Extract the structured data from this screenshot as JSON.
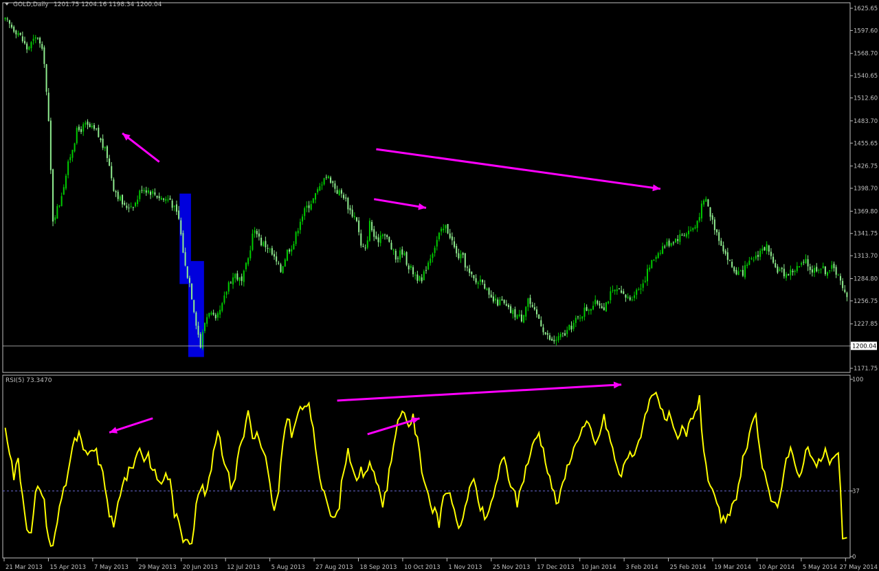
{
  "chart_data": [
    {
      "type": "candlestick",
      "title": "GOLD,Daily",
      "ohlc_readout": "1201.75 1204.16 1198.34 1200.04",
      "current_price": 1200.04,
      "y_ticks": [
        1171.75,
        1200.04,
        1227.85,
        1256.75,
        1284.8,
        1313.7,
        1341.75,
        1369.8,
        1398.7,
        1426.75,
        1455.65,
        1483.7,
        1512.6,
        1540.65,
        1568.7,
        1597.6,
        1625.65
      ],
      "ylim": [
        1171.75,
        1625.65
      ],
      "x_ticks": [
        "21 Mar 2013",
        "15 Apr 2013",
        "7 May 2013",
        "29 May 2013",
        "20 Jun 2013",
        "12 Jul 2013",
        "5 Aug 2013",
        "27 Aug 2013",
        "18 Sep 2013",
        "10 Oct 2013",
        "1 Nov 2013",
        "25 Nov 2013",
        "17 Dec 2013",
        "10 Jan 2014",
        "3 Feb 2014",
        "25 Feb 2014",
        "19 Mar 2014",
        "10 Apr 2014",
        "5 May 2014",
        "27 May 2014"
      ],
      "close_anchors": [
        [
          0,
          1610
        ],
        [
          6,
          1595
        ],
        [
          10,
          1575
        ],
        [
          15,
          1590
        ],
        [
          18,
          1560
        ],
        [
          20,
          1480
        ],
        [
          22,
          1360
        ],
        [
          25,
          1380
        ],
        [
          30,
          1440
        ],
        [
          33,
          1470
        ],
        [
          37,
          1478
        ],
        [
          42,
          1470
        ],
        [
          47,
          1440
        ],
        [
          50,
          1400
        ],
        [
          55,
          1375
        ],
        [
          60,
          1380
        ],
        [
          63,
          1400
        ],
        [
          67,
          1395
        ],
        [
          70,
          1390
        ],
        [
          73,
          1385
        ],
        [
          76,
          1385
        ],
        [
          80,
          1360
        ],
        [
          83,
          1300
        ],
        [
          85,
          1280
        ],
        [
          88,
          1230
        ],
        [
          90,
          1200
        ],
        [
          92,
          1230
        ],
        [
          94,
          1245
        ],
        [
          97,
          1230
        ],
        [
          100,
          1250
        ],
        [
          103,
          1280
        ],
        [
          106,
          1290
        ],
        [
          109,
          1280
        ],
        [
          112,
          1310
        ],
        [
          114,
          1340
        ],
        [
          116,
          1345
        ],
        [
          118,
          1330
        ],
        [
          121,
          1325
        ],
        [
          124,
          1310
        ],
        [
          127,
          1295
        ],
        [
          130,
          1320
        ],
        [
          133,
          1330
        ],
        [
          136,
          1360
        ],
        [
          139,
          1375
        ],
        [
          142,
          1385
        ],
        [
          145,
          1400
        ],
        [
          147,
          1415
        ],
        [
          150,
          1410
        ],
        [
          153,
          1395
        ],
        [
          156,
          1390
        ],
        [
          159,
          1370
        ],
        [
          162,
          1360
        ],
        [
          164,
          1325
        ],
        [
          166,
          1320
        ],
        [
          168,
          1355
        ],
        [
          171,
          1330
        ],
        [
          174,
          1345
        ],
        [
          177,
          1330
        ],
        [
          180,
          1310
        ],
        [
          183,
          1320
        ],
        [
          186,
          1300
        ],
        [
          189,
          1290
        ],
        [
          192,
          1280
        ],
        [
          194,
          1300
        ],
        [
          197,
          1320
        ],
        [
          200,
          1340
        ],
        [
          203,
          1350
        ],
        [
          205,
          1340
        ],
        [
          208,
          1315
        ],
        [
          211,
          1310
        ],
        [
          214,
          1290
        ],
        [
          217,
          1280
        ],
        [
          220,
          1285
        ],
        [
          223,
          1260
        ],
        [
          226,
          1255
        ],
        [
          229,
          1255
        ],
        [
          232,
          1245
        ],
        [
          235,
          1240
        ],
        [
          238,
          1235
        ],
        [
          241,
          1260
        ],
        [
          243,
          1245
        ],
        [
          246,
          1235
        ],
        [
          249,
          1215
        ],
        [
          252,
          1205
        ],
        [
          255,
          1210
        ],
        [
          258,
          1215
        ],
        [
          261,
          1225
        ],
        [
          264,
          1235
        ],
        [
          267,
          1245
        ],
        [
          270,
          1250
        ],
        [
          273,
          1255
        ],
        [
          276,
          1250
        ],
        [
          279,
          1265
        ],
        [
          282,
          1270
        ],
        [
          285,
          1262
        ],
        [
          288,
          1260
        ],
        [
          291,
          1270
        ],
        [
          294,
          1280
        ],
        [
          297,
          1300
        ],
        [
          300,
          1315
        ],
        [
          303,
          1325
        ],
        [
          306,
          1330
        ],
        [
          309,
          1335
        ],
        [
          312,
          1340
        ],
        [
          315,
          1345
        ],
        [
          318,
          1350
        ],
        [
          321,
          1375
        ],
        [
          323,
          1385
        ],
        [
          325,
          1365
        ],
        [
          327,
          1350
        ],
        [
          330,
          1330
        ],
        [
          333,
          1310
        ],
        [
          336,
          1295
        ],
        [
          339,
          1290
        ],
        [
          342,
          1300
        ],
        [
          345,
          1310
        ],
        [
          348,
          1320
        ],
        [
          351,
          1325
        ],
        [
          354,
          1300
        ],
        [
          357,
          1295
        ],
        [
          360,
          1290
        ],
        [
          363,
          1295
        ],
        [
          366,
          1300
        ],
        [
          369,
          1305
        ],
        [
          372,
          1295
        ],
        [
          375,
          1300
        ],
        [
          378,
          1295
        ],
        [
          381,
          1298
        ],
        [
          384,
          1292
        ],
        [
          386,
          1270
        ],
        [
          388,
          1260
        ]
      ],
      "bars": 389,
      "up_color": "#00cc00",
      "down_color": "#90ee90",
      "highlight_boxes": [
        {
          "from_bar": 81,
          "to_bar": 85,
          "price_top": 1392,
          "price_bottom": 1278
        },
        {
          "from_bar": 85,
          "to_bar": 91,
          "price_top": 1307,
          "price_bottom": 1186
        }
      ],
      "trend_arrows": [
        {
          "from": [
            71,
            1432
          ],
          "to": [
            54,
            1468
          ]
        },
        {
          "from": [
            170,
            1385
          ],
          "to": [
            194,
            1374
          ]
        },
        {
          "from": [
            171,
            1448
          ],
          "to": [
            302,
            1398
          ]
        }
      ]
    },
    {
      "type": "line",
      "title": "RSI(5) 73.3470",
      "series": [
        {
          "name": "RSI(5)",
          "color": "#ffff00"
        }
      ],
      "ylim": [
        0,
        100
      ],
      "y_ticks": [
        0,
        37,
        100
      ],
      "level": 37,
      "anchors": [
        [
          0,
          75
        ],
        [
          2,
          60
        ],
        [
          4,
          45
        ],
        [
          6,
          55
        ],
        [
          8,
          35
        ],
        [
          10,
          18
        ],
        [
          12,
          12
        ],
        [
          14,
          35
        ],
        [
          16,
          40
        ],
        [
          18,
          30
        ],
        [
          20,
          10
        ],
        [
          22,
          5
        ],
        [
          24,
          20
        ],
        [
          26,
          35
        ],
        [
          28,
          42
        ],
        [
          30,
          55
        ],
        [
          32,
          65
        ],
        [
          34,
          68
        ],
        [
          36,
          60
        ],
        [
          38,
          55
        ],
        [
          40,
          62
        ],
        [
          42,
          58
        ],
        [
          44,
          50
        ],
        [
          46,
          40
        ],
        [
          48,
          25
        ],
        [
          50,
          15
        ],
        [
          52,
          30
        ],
        [
          54,
          42
        ],
        [
          56,
          45
        ],
        [
          58,
          50
        ],
        [
          60,
          55
        ],
        [
          62,
          62
        ],
        [
          64,
          55
        ],
        [
          66,
          58
        ],
        [
          68,
          48
        ],
        [
          70,
          45
        ],
        [
          72,
          40
        ],
        [
          74,
          48
        ],
        [
          76,
          42
        ],
        [
          78,
          25
        ],
        [
          80,
          18
        ],
        [
          82,
          10
        ],
        [
          84,
          12
        ],
        [
          86,
          8
        ],
        [
          88,
          28
        ],
        [
          90,
          40
        ],
        [
          92,
          35
        ],
        [
          94,
          42
        ],
        [
          96,
          60
        ],
        [
          98,
          72
        ],
        [
          100,
          60
        ],
        [
          102,
          50
        ],
        [
          104,
          40
        ],
        [
          106,
          45
        ],
        [
          108,
          62
        ],
        [
          110,
          68
        ],
        [
          112,
          85
        ],
        [
          114,
          65
        ],
        [
          116,
          70
        ],
        [
          118,
          60
        ],
        [
          120,
          55
        ],
        [
          122,
          40
        ],
        [
          124,
          25
        ],
        [
          126,
          35
        ],
        [
          128,
          65
        ],
        [
          130,
          80
        ],
        [
          132,
          70
        ],
        [
          134,
          75
        ],
        [
          136,
          85
        ],
        [
          138,
          82
        ],
        [
          140,
          88
        ],
        [
          142,
          70
        ],
        [
          144,
          50
        ],
        [
          146,
          40
        ],
        [
          148,
          35
        ],
        [
          150,
          25
        ],
        [
          152,
          20
        ],
        [
          154,
          30
        ],
        [
          156,
          50
        ],
        [
          158,
          60
        ],
        [
          160,
          52
        ],
        [
          162,
          40
        ],
        [
          164,
          48
        ],
        [
          166,
          45
        ],
        [
          168,
          55
        ],
        [
          170,
          45
        ],
        [
          172,
          40
        ],
        [
          174,
          30
        ],
        [
          176,
          40
        ],
        [
          178,
          55
        ],
        [
          180,
          72
        ],
        [
          182,
          78
        ],
        [
          184,
          80
        ],
        [
          186,
          75
        ],
        [
          188,
          78
        ],
        [
          190,
          65
        ],
        [
          192,
          50
        ],
        [
          194,
          40
        ],
        [
          196,
          30
        ],
        [
          198,
          25
        ],
        [
          200,
          18
        ],
        [
          202,
          35
        ],
        [
          204,
          38
        ],
        [
          206,
          28
        ],
        [
          208,
          22
        ],
        [
          210,
          15
        ],
        [
          212,
          28
        ],
        [
          214,
          40
        ],
        [
          216,
          42
        ],
        [
          218,
          30
        ],
        [
          220,
          25
        ],
        [
          222,
          20
        ],
        [
          224,
          30
        ],
        [
          226,
          40
        ],
        [
          228,
          50
        ],
        [
          230,
          55
        ],
        [
          232,
          45
        ],
        [
          234,
          38
        ],
        [
          236,
          30
        ],
        [
          238,
          40
        ],
        [
          240,
          50
        ],
        [
          242,
          58
        ],
        [
          244,
          65
        ],
        [
          246,
          70
        ],
        [
          248,
          60
        ],
        [
          250,
          50
        ],
        [
          252,
          40
        ],
        [
          254,
          30
        ],
        [
          256,
          35
        ],
        [
          258,
          45
        ],
        [
          260,
          55
        ],
        [
          262,
          60
        ],
        [
          264,
          68
        ],
        [
          266,
          72
        ],
        [
          268,
          75
        ],
        [
          270,
          70
        ],
        [
          272,
          62
        ],
        [
          274,
          70
        ],
        [
          276,
          78
        ],
        [
          278,
          70
        ],
        [
          280,
          60
        ],
        [
          282,
          50
        ],
        [
          284,
          45
        ],
        [
          286,
          55
        ],
        [
          288,
          60
        ],
        [
          290,
          55
        ],
        [
          292,
          65
        ],
        [
          294,
          75
        ],
        [
          296,
          85
        ],
        [
          298,
          90
        ],
        [
          300,
          95
        ],
        [
          302,
          85
        ],
        [
          304,
          75
        ],
        [
          306,
          80
        ],
        [
          308,
          70
        ],
        [
          310,
          65
        ],
        [
          312,
          72
        ],
        [
          314,
          68
        ],
        [
          316,
          78
        ],
        [
          318,
          82
        ],
        [
          320,
          88
        ],
        [
          322,
          60
        ],
        [
          324,
          45
        ],
        [
          326,
          35
        ],
        [
          328,
          28
        ],
        [
          330,
          22
        ],
        [
          332,
          18
        ],
        [
          334,
          25
        ],
        [
          336,
          30
        ],
        [
          338,
          40
        ],
        [
          340,
          55
        ],
        [
          342,
          62
        ],
        [
          344,
          72
        ],
        [
          346,
          78
        ],
        [
          348,
          60
        ],
        [
          350,
          45
        ],
        [
          352,
          35
        ],
        [
          354,
          28
        ],
        [
          356,
          30
        ],
        [
          358,
          42
        ],
        [
          360,
          55
        ],
        [
          362,
          60
        ],
        [
          364,
          50
        ],
        [
          366,
          45
        ],
        [
          368,
          55
        ],
        [
          370,
          62
        ],
        [
          372,
          58
        ],
        [
          374,
          50
        ],
        [
          376,
          55
        ],
        [
          378,
          60
        ],
        [
          380,
          52
        ],
        [
          382,
          55
        ],
        [
          384,
          58
        ],
        [
          386,
          12
        ],
        [
          388,
          8
        ]
      ],
      "x_ticks": [
        "21 Mar 2013",
        "15 Apr 2013",
        "7 May 2013",
        "29 May 2013",
        "20 Jun 2013",
        "12 Jul 2013",
        "5 Aug 2013",
        "27 Aug 2013",
        "18 Sep 2013",
        "10 Oct 2013",
        "1 Nov 2013",
        "25 Nov 2013",
        "17 Dec 2013",
        "10 Jan 2014",
        "3 Feb 2014",
        "25 Feb 2014",
        "19 Mar 2014",
        "10 Apr 2014",
        "5 May 2014",
        "27 May 2014"
      ],
      "trend_arrows": [
        {
          "from": [
            68,
            78
          ],
          "to": [
            48,
            70
          ]
        },
        {
          "from": [
            167,
            69
          ],
          "to": [
            191,
            78
          ]
        },
        {
          "from": [
            153,
            88
          ],
          "to": [
            284,
            97
          ]
        }
      ]
    }
  ],
  "colors": {
    "background": "#000000",
    "axis": "#c0c0c0",
    "arrow": "#ff00ff",
    "highlight": "#0000dd",
    "level_line": "#6666cc"
  }
}
